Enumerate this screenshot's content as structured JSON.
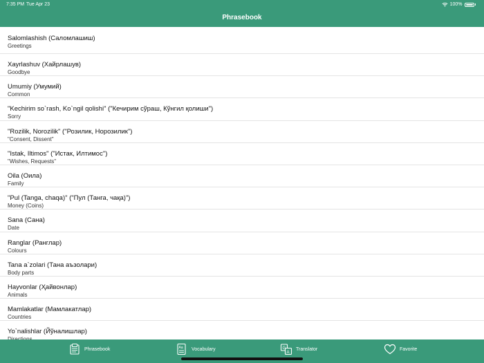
{
  "status": {
    "time": "7:35 PM",
    "date": "Tue Apr 23",
    "battery": "100%"
  },
  "nav": {
    "title": "Phrasebook"
  },
  "items": [
    {
      "title": "Salomlashish (Саломлашиш)",
      "sub": "Greetings"
    },
    {
      "title": "Xayrlashuv (Хайрлашув)",
      "sub": "Goodbye"
    },
    {
      "title": "Umumiy (Умумий)",
      "sub": "Common"
    },
    {
      "title": "\"Kechirim so`rash, Ko`ngil qolishi\" (\"Кечирим сўраш, Кўнгил қолиши\")",
      "sub": "Sorry"
    },
    {
      "title": "\"Rozilik, Norozilik\" (\"Розилик, Норозилик\")",
      "sub": "\"Consent, Dissent\""
    },
    {
      "title": "\"Istak, Iltimos\" (\"Истак, Илтимос\")",
      "sub": "\"Wishes, Requests\""
    },
    {
      "title": "Oila (Оила)",
      "sub": "Family"
    },
    {
      "title": "\"Pul (Tanga, chaqa)\" (\"Пул (Танга, чақа)\")",
      "sub": "Money (Coins)"
    },
    {
      "title": "Sana (Сана)",
      "sub": "Date"
    },
    {
      "title": "Ranglar (Ранглар)",
      "sub": "Colours"
    },
    {
      "title": "Tana a`zolari (Тана аъзолари)",
      "sub": "Body parts"
    },
    {
      "title": "Hayvonlar (Ҳайвонлар)",
      "sub": "Animals"
    },
    {
      "title": "Mamlakatlar (Мамлакатлар)",
      "sub": "Countries"
    },
    {
      "title": "Yo`nalishlar (Йўналишлар)",
      "sub": "Directions"
    }
  ],
  "tabs": [
    {
      "label": "Phrasebook",
      "icon": "phrasebook-icon"
    },
    {
      "label": "Vocabulary",
      "icon": "vocabulary-icon"
    },
    {
      "label": "Translator",
      "icon": "translator-icon"
    },
    {
      "label": "Favorite",
      "icon": "heart-icon"
    }
  ],
  "colors": {
    "accent": "#3a9a7a",
    "text": "#111111",
    "divider": "#e4e4e4"
  }
}
